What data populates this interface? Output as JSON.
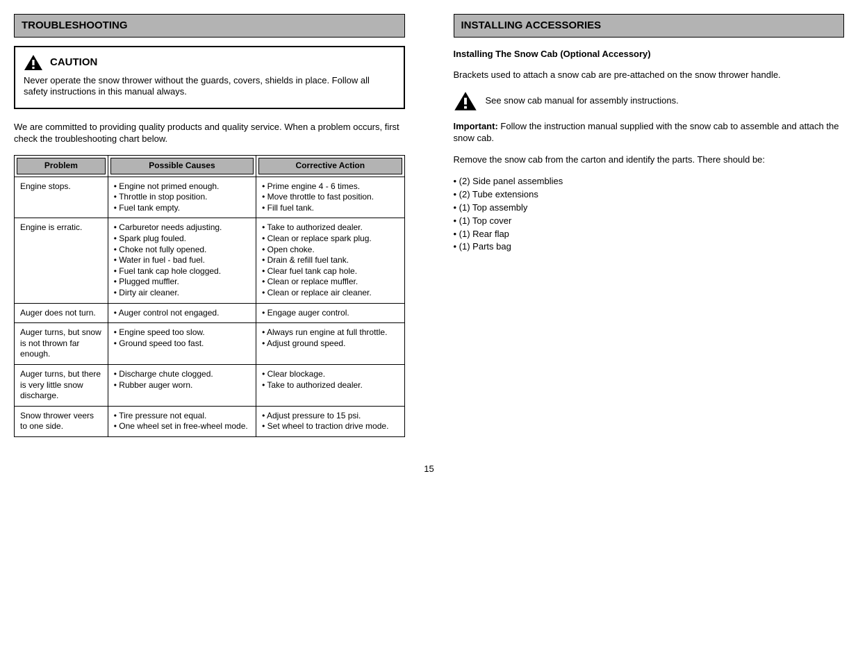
{
  "left": {
    "header": "TROUBLESHOOTING",
    "caution_label": "CAUTION",
    "caution_body": "Never operate the snow thrower without the guards, covers, shields in place. Follow all safety instructions in this manual always.",
    "intro": "We are committed to providing quality products and quality service. When a problem occurs, first check the troubleshooting chart below.",
    "table": {
      "headers": [
        "Problem",
        "Possible Causes",
        "Corrective Action"
      ],
      "rows": [
        {
          "c1": "Engine stops.",
          "c2": "• Engine not primed enough.\n• Throttle in stop position.\n• Fuel tank empty.",
          "c3": "• Prime engine 4 - 6 times.\n• Move throttle to fast position.\n• Fill fuel tank."
        },
        {
          "c1": "Engine is erratic.",
          "c2": "• Carburetor needs adjusting.\n• Spark plug fouled.\n• Choke not fully opened.\n• Water in fuel - bad fuel.\n• Fuel tank cap hole clogged.\n• Plugged muffler.\n• Dirty air cleaner.",
          "c3": "• Take to authorized dealer.\n• Clean or replace spark plug.\n• Open choke.\n• Drain & refill fuel tank.\n• Clear fuel tank cap hole.\n• Clean or replace muffler.\n• Clean or replace air cleaner."
        },
        {
          "c1": "Auger does not turn.",
          "c2": "• Auger control not engaged.",
          "c3": "• Engage auger control."
        },
        {
          "c1": "Auger turns, but snow is not thrown far enough.",
          "c2": "• Engine speed too slow.\n• Ground speed too fast.",
          "c3": "• Always run engine at full throttle.\n• Adjust ground speed."
        },
        {
          "c1": "Auger turns, but there is very little snow discharge.",
          "c2": "• Discharge chute clogged.\n• Rubber auger worn.",
          "c3": "• Clear blockage.\n• Take to authorized dealer."
        },
        {
          "c1": "Snow thrower veers to one side.",
          "c2": "• Tire pressure not equal.\n• One wheel set in free-wheel mode.",
          "c3": "• Adjust pressure to 15 psi.\n• Set wheel to traction drive mode."
        }
      ]
    }
  },
  "right": {
    "header": "INSTALLING ACCESSORIES",
    "sub": "Installing The Snow Cab (Optional Accessory)",
    "body1": "Brackets used to attach a snow cab are pre-attached on the snow thrower handle.",
    "icon_label": "See snow cab manual for assembly instructions.",
    "body2_label": "Important:",
    "body2": " Follow the instruction manual supplied with the snow cab to assemble and attach the snow cab.",
    "body3": "Remove the snow cab from the carton and identify the parts. There should be:",
    "parts": [
      "• (2) Side panel assemblies",
      "• (2) Tube extensions",
      "• (1) Top assembly",
      "• (1) Top cover",
      "• (1) Rear flap",
      "• (1) Parts bag"
    ]
  },
  "page_number": "15"
}
